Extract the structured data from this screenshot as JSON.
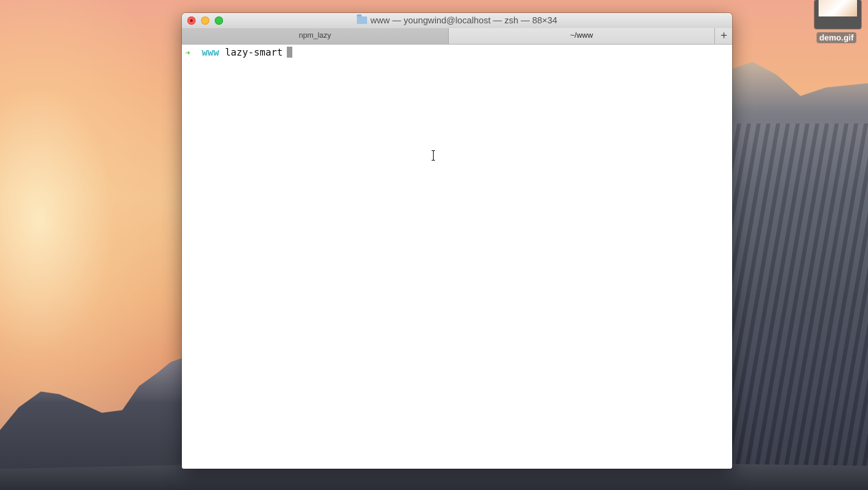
{
  "desktop": {
    "file_label": "demo.gif",
    "file_icon": "gif-thumbnail-icon"
  },
  "window": {
    "title": "www — youngwind@localhost — zsh — 88×34",
    "title_icon": "folder-icon",
    "tabs": [
      {
        "label": "npm_lazy",
        "active": false
      },
      {
        "label": "~/www",
        "active": true
      }
    ],
    "new_tab_label": "+"
  },
  "terminal": {
    "prompt_arrow": "➜",
    "cwd": "www",
    "command": "lazy-smart",
    "arrow_color": "#5ac74d",
    "cwd_color": "#3fb5c8"
  }
}
